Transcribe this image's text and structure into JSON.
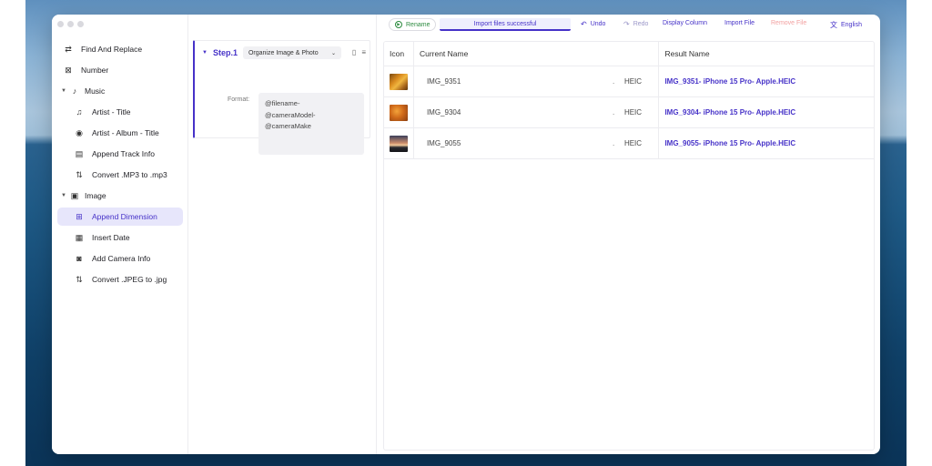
{
  "colors": {
    "accent": "#4632c8",
    "success": "#2b8a3e",
    "disabled": "#f2a0a0"
  },
  "sidebar": {
    "items": [
      {
        "label": "Find And Replace",
        "icon": "find-replace-icon",
        "level": 0
      },
      {
        "label": "Number",
        "icon": "number-icon",
        "level": 0
      },
      {
        "label": "Music",
        "icon": "music-note-icon",
        "level": 0,
        "expanded": true
      },
      {
        "label": "Artist - Title",
        "icon": "person-music-icon",
        "level": 1
      },
      {
        "label": "Artist - Album - Title",
        "icon": "disc-icon",
        "level": 1
      },
      {
        "label": "Append Track Info",
        "icon": "track-info-icon",
        "level": 1
      },
      {
        "label": "Convert .MP3 to .mp3",
        "icon": "convert-icon",
        "level": 1
      },
      {
        "label": "Image",
        "icon": "image-icon",
        "level": 0,
        "expanded": true
      },
      {
        "label": "Append Dimension",
        "icon": "dimension-icon",
        "level": 1,
        "active": true
      },
      {
        "label": "Insert Date",
        "icon": "calendar-icon",
        "level": 1
      },
      {
        "label": "Add Camera Info",
        "icon": "camera-icon",
        "level": 1
      },
      {
        "label": "Convert .JPEG to .jpg",
        "icon": "convert-icon",
        "level": 1
      }
    ]
  },
  "step": {
    "title": "Step.1",
    "preset": "Organize Image & Photo",
    "format_label": "Format:",
    "format_value": "@filename-\n@cameraModel-\n@cameraMake"
  },
  "toolbar": {
    "rename": "Rename",
    "status": "Import files successful",
    "undo": "Undo",
    "redo": "Redo",
    "display_column": "Display Column",
    "import_file": "Import File",
    "remove_file": "Remove File",
    "language": "English"
  },
  "table": {
    "headers": {
      "icon": "Icon",
      "current": "Current Name",
      "result": "Result Name"
    },
    "rows": [
      {
        "name": "IMG_9351",
        "dot": ".",
        "ext": "HEIC",
        "result": "IMG_9351- iPhone 15 Pro- Apple.HEIC",
        "thumb": "autumn-tree-thumbnail"
      },
      {
        "name": "IMG_9304",
        "dot": ".",
        "ext": "HEIC",
        "result": "IMG_9304- iPhone 15 Pro- Apple.HEIC",
        "thumb": "autumn-leaves-thumbnail"
      },
      {
        "name": "IMG_9055",
        "dot": ".",
        "ext": "HEIC",
        "result": "IMG_9055- iPhone 15 Pro- Apple.HEIC",
        "thumb": "sunset-silhouette-thumbnail"
      }
    ]
  }
}
